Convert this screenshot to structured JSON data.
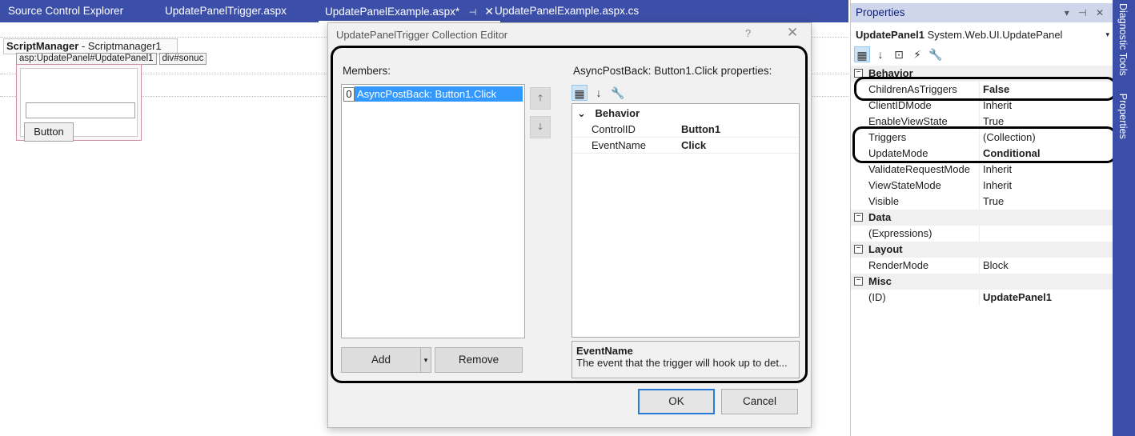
{
  "tabs": {
    "source_control": "Source Control Explorer",
    "tab1": "UpdatePanelTrigger.aspx",
    "tab2": "UpdatePanelExample.aspx*",
    "tab3": "UpdatePanelExample.aspx.cs"
  },
  "designer": {
    "script_manager_bold": "ScriptManager",
    "script_manager_rest": " - Scriptmanager1",
    "tag_updatepanel": "asp:UpdatePanel#UpdatePanel1",
    "tag_div": "div#sonuc",
    "button_label": "Button"
  },
  "dialog": {
    "title": "UpdatePanelTrigger Collection Editor",
    "help": "?",
    "members_label": "Members:",
    "members": [
      {
        "index": "0",
        "label": "AsyncPostBack: Button1.Click"
      }
    ],
    "properties_label": "AsyncPostBack: Button1.Click properties:",
    "category": "Behavior",
    "properties": [
      {
        "name": "ControlID",
        "value": "Button1"
      },
      {
        "name": "EventName",
        "value": "Click"
      }
    ],
    "description_title": "EventName",
    "description_text": "The event that the trigger will hook up to det...",
    "add_label": "Add",
    "remove_label": "Remove",
    "ok_label": "OK",
    "cancel_label": "Cancel"
  },
  "properties_window": {
    "title": "Properties",
    "object_name": "UpdatePanel1",
    "object_type": " System.Web.UI.UpdatePanel",
    "behavior_label": "Behavior",
    "rows": [
      {
        "name": "ChildrenAsTriggers",
        "value": "False"
      },
      {
        "name": "ClientIDMode",
        "value": "Inherit"
      },
      {
        "name": "EnableViewState",
        "value": "True"
      },
      {
        "name": "Triggers",
        "value": "(Collection)"
      },
      {
        "name": "UpdateMode",
        "value": "Conditional"
      },
      {
        "name": "ValidateRequestMode",
        "value": "Inherit"
      },
      {
        "name": "ViewStateMode",
        "value": "Inherit"
      },
      {
        "name": "Visible",
        "value": "True"
      }
    ],
    "data_label": "Data",
    "data_rows": [
      {
        "name": "(Expressions)",
        "value": ""
      }
    ],
    "layout_label": "Layout",
    "layout_rows": [
      {
        "name": "RenderMode",
        "value": "Block"
      }
    ],
    "misc_label": "Misc",
    "misc_rows": [
      {
        "name": "(ID)",
        "value": "UpdatePanel1"
      }
    ]
  },
  "rail": {
    "diagnostic": "Diagnostic Tools",
    "properties": "Properties"
  }
}
